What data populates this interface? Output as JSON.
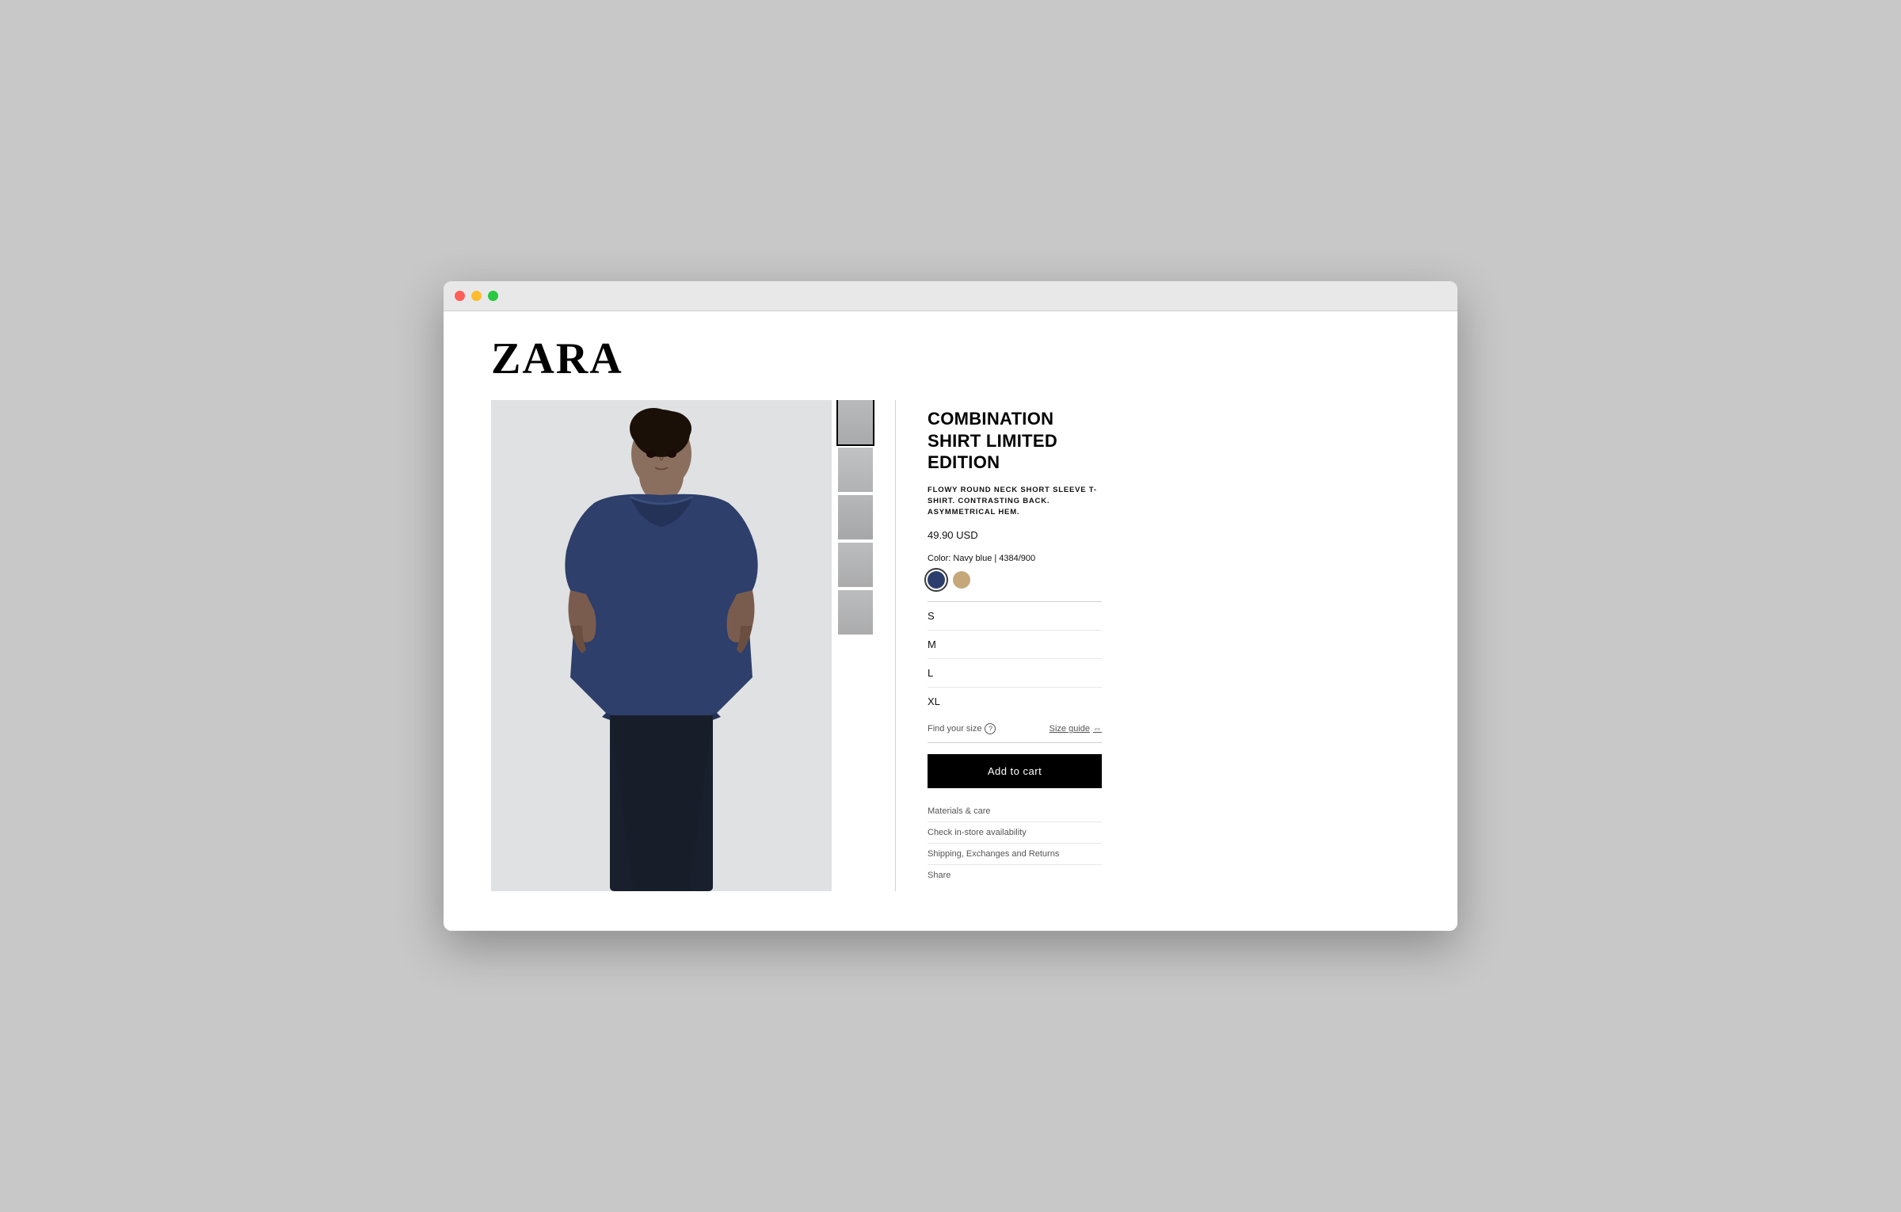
{
  "browser": {
    "traffic_lights": [
      "close",
      "minimize",
      "maximize"
    ]
  },
  "header": {
    "logo": "ZARA"
  },
  "product": {
    "title": "COMBINATION SHIRT LIMITED EDITION",
    "description": "FLOWY ROUND NECK SHORT SLEEVE T-SHIRT. CONTRASTING BACK. ASYMMETRICAL HEM.",
    "price": "49.90 USD",
    "color_label": "Color: Navy blue | 4384/900",
    "swatches": [
      {
        "name": "navy",
        "color": "#2c3e6b",
        "selected": true
      },
      {
        "name": "tan",
        "color": "#c4a87a",
        "selected": false
      }
    ],
    "sizes": [
      "S",
      "M",
      "L",
      "XL"
    ],
    "find_size_label": "Find your size",
    "size_guide_label": "Size guide",
    "add_to_cart_label": "Add to cart",
    "info_links": [
      "Materials & care",
      "Check in-store availability",
      "Shipping, Exchanges and Returns",
      "Share"
    ],
    "thumbnails": [
      1,
      2,
      3,
      4,
      5
    ]
  }
}
